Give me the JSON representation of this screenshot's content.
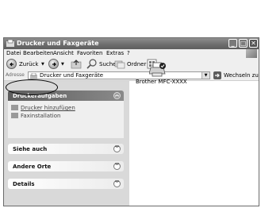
{
  "window": {
    "title": "Drucker und Faxgeräte"
  },
  "menu": [
    "Datei",
    "Bearbeiten",
    "Ansicht",
    "Favoriten",
    "Extras",
    "?"
  ],
  "toolbar": {
    "back": "Zurück",
    "search": "Suchen",
    "folders": "Ordner"
  },
  "address": {
    "label": "Adresse",
    "value": "Drucker und Faxgeräte",
    "go": "Wechseln zu"
  },
  "task_pane": {
    "panels": [
      {
        "title": "Druckeraufgaben",
        "items": [
          "Drucker hinzufügen",
          "Faxinstallation"
        ]
      },
      {
        "title": "Siehe auch",
        "items": []
      },
      {
        "title": "Andere Orte",
        "items": []
      },
      {
        "title": "Details",
        "items": []
      }
    ]
  },
  "printer": {
    "name": "Brother MFC-XXXX",
    "icon": "printer-icon"
  }
}
